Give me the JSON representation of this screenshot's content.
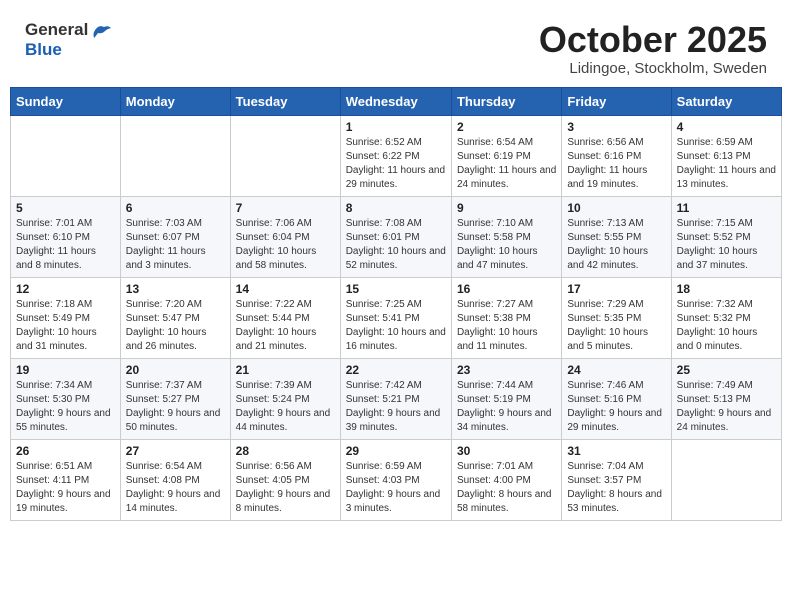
{
  "header": {
    "logo_general": "General",
    "logo_blue": "Blue",
    "month_title": "October 2025",
    "location": "Lidingoe, Stockholm, Sweden"
  },
  "weekdays": [
    "Sunday",
    "Monday",
    "Tuesday",
    "Wednesday",
    "Thursday",
    "Friday",
    "Saturday"
  ],
  "weeks": [
    [
      {
        "day": "",
        "info": ""
      },
      {
        "day": "",
        "info": ""
      },
      {
        "day": "",
        "info": ""
      },
      {
        "day": "1",
        "info": "Sunrise: 6:52 AM\nSunset: 6:22 PM\nDaylight: 11 hours\nand 29 minutes."
      },
      {
        "day": "2",
        "info": "Sunrise: 6:54 AM\nSunset: 6:19 PM\nDaylight: 11 hours\nand 24 minutes."
      },
      {
        "day": "3",
        "info": "Sunrise: 6:56 AM\nSunset: 6:16 PM\nDaylight: 11 hours\nand 19 minutes."
      },
      {
        "day": "4",
        "info": "Sunrise: 6:59 AM\nSunset: 6:13 PM\nDaylight: 11 hours\nand 13 minutes."
      }
    ],
    [
      {
        "day": "5",
        "info": "Sunrise: 7:01 AM\nSunset: 6:10 PM\nDaylight: 11 hours\nand 8 minutes."
      },
      {
        "day": "6",
        "info": "Sunrise: 7:03 AM\nSunset: 6:07 PM\nDaylight: 11 hours\nand 3 minutes."
      },
      {
        "day": "7",
        "info": "Sunrise: 7:06 AM\nSunset: 6:04 PM\nDaylight: 10 hours\nand 58 minutes."
      },
      {
        "day": "8",
        "info": "Sunrise: 7:08 AM\nSunset: 6:01 PM\nDaylight: 10 hours\nand 52 minutes."
      },
      {
        "day": "9",
        "info": "Sunrise: 7:10 AM\nSunset: 5:58 PM\nDaylight: 10 hours\nand 47 minutes."
      },
      {
        "day": "10",
        "info": "Sunrise: 7:13 AM\nSunset: 5:55 PM\nDaylight: 10 hours\nand 42 minutes."
      },
      {
        "day": "11",
        "info": "Sunrise: 7:15 AM\nSunset: 5:52 PM\nDaylight: 10 hours\nand 37 minutes."
      }
    ],
    [
      {
        "day": "12",
        "info": "Sunrise: 7:18 AM\nSunset: 5:49 PM\nDaylight: 10 hours\nand 31 minutes."
      },
      {
        "day": "13",
        "info": "Sunrise: 7:20 AM\nSunset: 5:47 PM\nDaylight: 10 hours\nand 26 minutes."
      },
      {
        "day": "14",
        "info": "Sunrise: 7:22 AM\nSunset: 5:44 PM\nDaylight: 10 hours\nand 21 minutes."
      },
      {
        "day": "15",
        "info": "Sunrise: 7:25 AM\nSunset: 5:41 PM\nDaylight: 10 hours\nand 16 minutes."
      },
      {
        "day": "16",
        "info": "Sunrise: 7:27 AM\nSunset: 5:38 PM\nDaylight: 10 hours\nand 11 minutes."
      },
      {
        "day": "17",
        "info": "Sunrise: 7:29 AM\nSunset: 5:35 PM\nDaylight: 10 hours\nand 5 minutes."
      },
      {
        "day": "18",
        "info": "Sunrise: 7:32 AM\nSunset: 5:32 PM\nDaylight: 10 hours\nand 0 minutes."
      }
    ],
    [
      {
        "day": "19",
        "info": "Sunrise: 7:34 AM\nSunset: 5:30 PM\nDaylight: 9 hours\nand 55 minutes."
      },
      {
        "day": "20",
        "info": "Sunrise: 7:37 AM\nSunset: 5:27 PM\nDaylight: 9 hours\nand 50 minutes."
      },
      {
        "day": "21",
        "info": "Sunrise: 7:39 AM\nSunset: 5:24 PM\nDaylight: 9 hours\nand 44 minutes."
      },
      {
        "day": "22",
        "info": "Sunrise: 7:42 AM\nSunset: 5:21 PM\nDaylight: 9 hours\nand 39 minutes."
      },
      {
        "day": "23",
        "info": "Sunrise: 7:44 AM\nSunset: 5:19 PM\nDaylight: 9 hours\nand 34 minutes."
      },
      {
        "day": "24",
        "info": "Sunrise: 7:46 AM\nSunset: 5:16 PM\nDaylight: 9 hours\nand 29 minutes."
      },
      {
        "day": "25",
        "info": "Sunrise: 7:49 AM\nSunset: 5:13 PM\nDaylight: 9 hours\nand 24 minutes."
      }
    ],
    [
      {
        "day": "26",
        "info": "Sunrise: 6:51 AM\nSunset: 4:11 PM\nDaylight: 9 hours\nand 19 minutes."
      },
      {
        "day": "27",
        "info": "Sunrise: 6:54 AM\nSunset: 4:08 PM\nDaylight: 9 hours\nand 14 minutes."
      },
      {
        "day": "28",
        "info": "Sunrise: 6:56 AM\nSunset: 4:05 PM\nDaylight: 9 hours\nand 8 minutes."
      },
      {
        "day": "29",
        "info": "Sunrise: 6:59 AM\nSunset: 4:03 PM\nDaylight: 9 hours\nand 3 minutes."
      },
      {
        "day": "30",
        "info": "Sunrise: 7:01 AM\nSunset: 4:00 PM\nDaylight: 8 hours\nand 58 minutes."
      },
      {
        "day": "31",
        "info": "Sunrise: 7:04 AM\nSunset: 3:57 PM\nDaylight: 8 hours\nand 53 minutes."
      },
      {
        "day": "",
        "info": ""
      }
    ]
  ]
}
